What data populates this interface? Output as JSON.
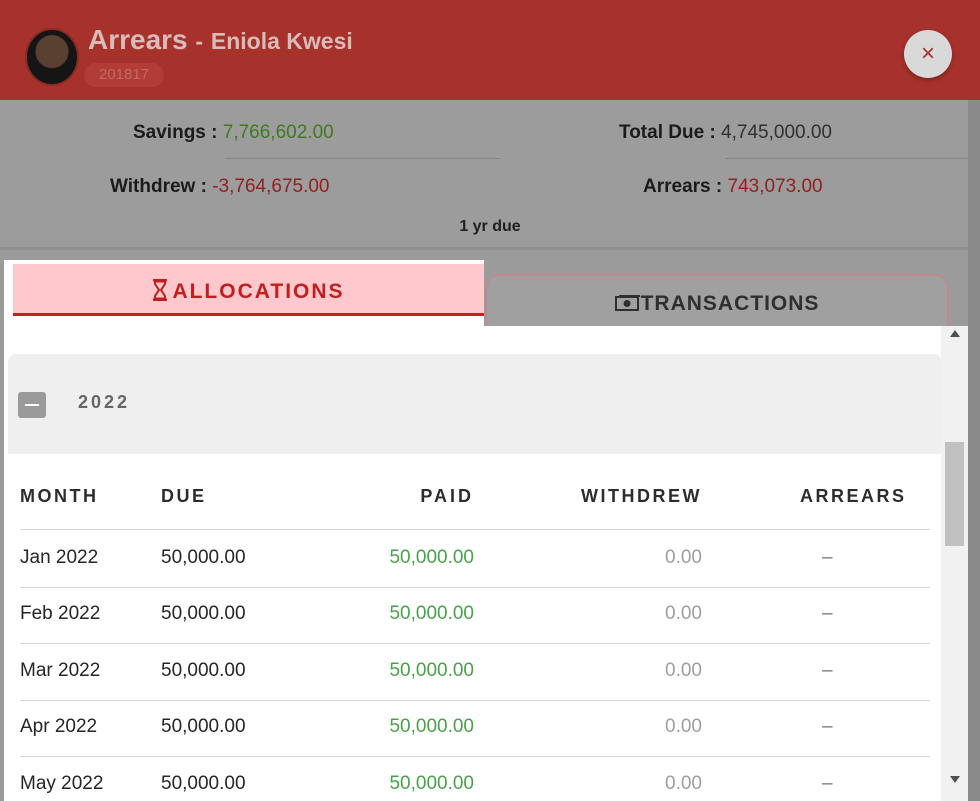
{
  "header": {
    "title": "Arrears",
    "separator": "-",
    "name": "Eniola Kwesi",
    "member_id": "201817",
    "close_label": "×"
  },
  "summary": {
    "savings_label": "Savings",
    "savings_value": "7,766,602.00",
    "total_due_label": "Total Due",
    "total_due_value": "4,745,000.00",
    "withdrew_label": "Withdrew",
    "withdrew_value": "-3,764,675.00",
    "arrears_label": "Arrears",
    "arrears_value": "743,073.00",
    "colon": ":",
    "due_note": "1 yr due"
  },
  "tabs": [
    {
      "label": "ALLOCATIONS",
      "icon": "hourglass-icon",
      "active": true
    },
    {
      "label": "TRANSACTIONS",
      "icon": "money-icon",
      "active": false
    }
  ],
  "group": {
    "year": "2022",
    "toggle": "collapse"
  },
  "table": {
    "headers": {
      "month": "MONTH",
      "due": "DUE",
      "paid": "PAID",
      "withdrew": "WITHDREW",
      "arrears": "ARREARS"
    },
    "rows": [
      {
        "month": "Jan 2022",
        "due": "50,000.00",
        "paid": "50,000.00",
        "withdrew": "0.00",
        "arrears": "–"
      },
      {
        "month": "Feb 2022",
        "due": "50,000.00",
        "paid": "50,000.00",
        "withdrew": "0.00",
        "arrears": "–"
      },
      {
        "month": "Mar 2022",
        "due": "50,000.00",
        "paid": "50,000.00",
        "withdrew": "0.00",
        "arrears": "–"
      },
      {
        "month": "Apr 2022",
        "due": "50,000.00",
        "paid": "50,000.00",
        "withdrew": "0.00",
        "arrears": "–"
      },
      {
        "month": "May 2022",
        "due": "50,000.00",
        "paid": "50,000.00",
        "withdrew": "0.00",
        "arrears": "–"
      }
    ]
  },
  "colors": {
    "header_red": "#a7312b",
    "accent_red": "#c72020",
    "paid_green": "#49a24b",
    "tab_active_bg": "#fec8cc"
  }
}
